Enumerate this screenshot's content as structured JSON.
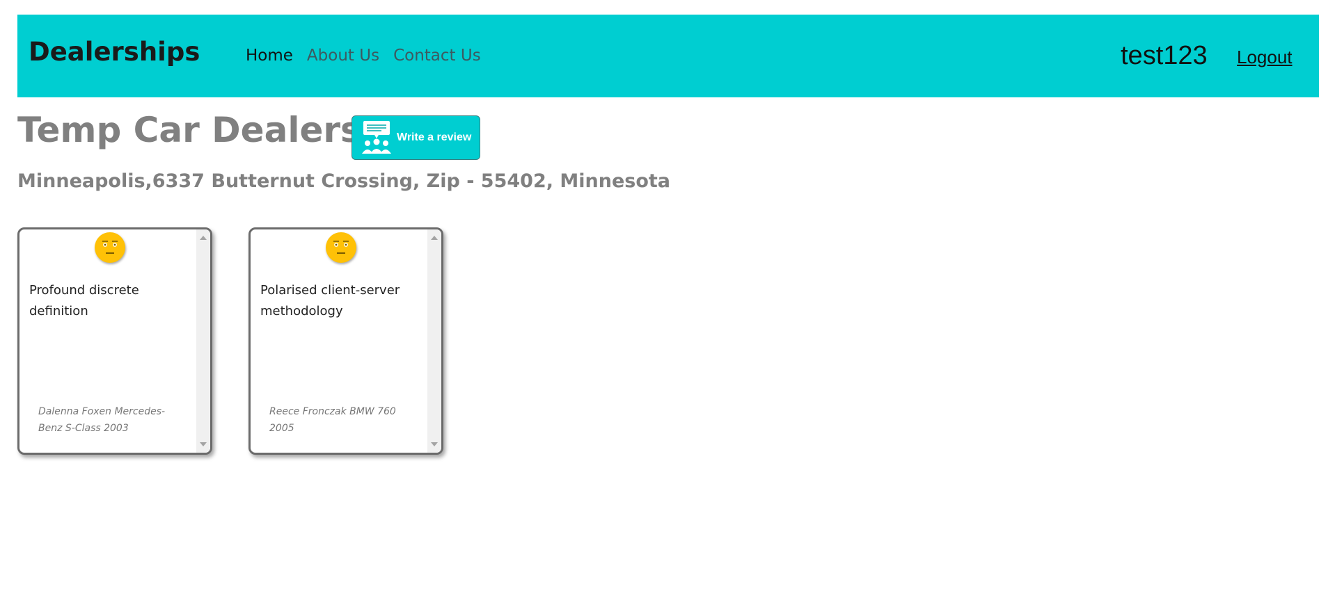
{
  "nav": {
    "brand": "Dealerships",
    "links": [
      {
        "label": "Home",
        "active": true
      },
      {
        "label": "About Us"
      },
      {
        "label": "Contact Us"
      }
    ],
    "username": "test123",
    "logout_label": "Logout",
    "bar_color": "#00ced1"
  },
  "dealer": {
    "name": "Temp Car Dealership",
    "address": "Minneapolis,6337 Butternut Crossing, Zip - 55402, Minnesota",
    "review_button_label": "Write a review"
  },
  "reviews": [
    {
      "sentiment_icon": "neutral-face-icon",
      "text": "Profound discrete definition",
      "reviewer": "Dalenna Foxen Mercedes-Benz S-Class 2003"
    },
    {
      "sentiment_icon": "neutral-face-icon",
      "text": "Polarised client-server methodology",
      "reviewer": "Reece Fronczak BMW 760 2005"
    }
  ]
}
